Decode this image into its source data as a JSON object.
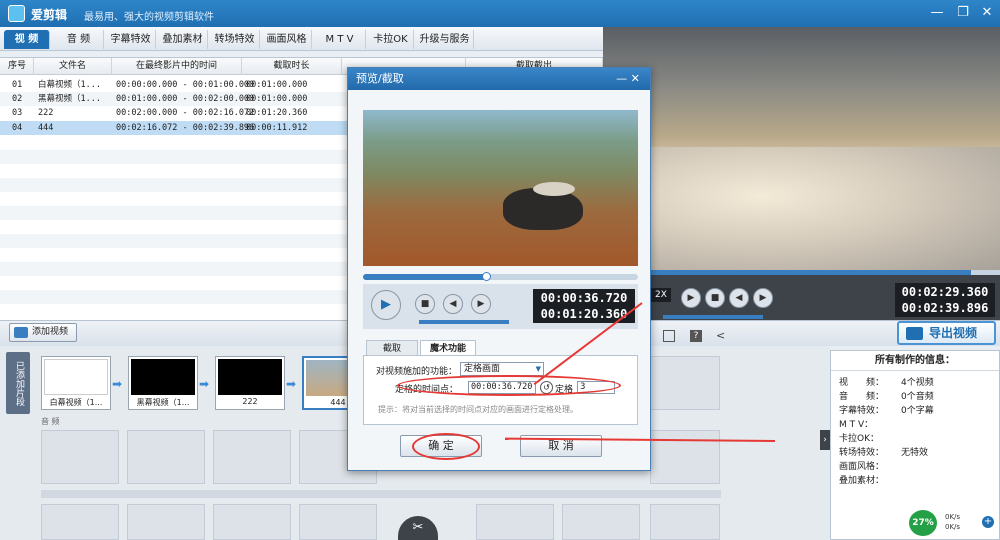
{
  "window": {
    "title": "爱剪辑",
    "slogan": "最易用、强大的视频剪辑软件"
  },
  "tabs": [
    "视 频",
    "音 频",
    "字幕特效",
    "叠加素材",
    "转场特效",
    "画面风格",
    "M T V",
    "卡拉OK",
    "升级与服务"
  ],
  "table": {
    "headers": [
      "序号",
      "文件名",
      "在最终影片中的时间",
      "截取时长"
    ],
    "rows": [
      {
        "no": "01",
        "name": "白幕视频（1...",
        "time": "00:00:00.000 - 00:01:00.000",
        "dur": "00:01:00.000"
      },
      {
        "no": "02",
        "name": "黑幕视频（1...",
        "time": "00:01:00.000 - 00:02:00.000",
        "dur": "00:01:00.000"
      },
      {
        "no": "03",
        "name": "222",
        "time": "00:02:00.000 - 00:02:16.072",
        "dur": "00:01:20.360"
      },
      {
        "no": "04",
        "name": "444",
        "time": "00:02:16.072 - 00:02:39.896",
        "dur": "00:00:11.912"
      }
    ]
  },
  "preview": {
    "time_current": "00:02:29.360",
    "time_total": "00:02:39.896",
    "speed": "2X",
    "side_header": "截取截出"
  },
  "export_label": "导出视频",
  "add_video_label": "添加视频",
  "clip_panel": {
    "side_label": "已添加片段",
    "clips": [
      "白幕视频（1...",
      "黑幕视频（1...",
      "222",
      "444"
    ],
    "audio_label": "音 频"
  },
  "info": {
    "title": "所有制作的信息：",
    "rows": [
      {
        "k": "视　　频：",
        "v": "4个视频"
      },
      {
        "k": "音　　频：",
        "v": "0个音频"
      },
      {
        "k": "字幕特效：",
        "v": "0个字幕"
      },
      {
        "k": "M T V：",
        "v": ""
      },
      {
        "k": "卡拉OK：",
        "v": ""
      },
      {
        "k": "转场特效：",
        "v": "无特效"
      },
      {
        "k": "画面风格：",
        "v": ""
      },
      {
        "k": "叠加素材：",
        "v": ""
      }
    ],
    "badge": "27%",
    "net_up": "0K/s",
    "net_down": "0K/s"
  },
  "modal": {
    "title": "预览/截取",
    "time_current": "00:00:36.720",
    "time_total": "00:01:20.360",
    "tabs": [
      "截取",
      "魔术功能"
    ],
    "func_label": "对视频施加的功能：",
    "func_value": "定格画面",
    "freeze_time_label": "定格的时间点：",
    "freeze_time_value": "00:00:36.720",
    "freeze_dur_label": "定格",
    "freeze_dur_value": "3",
    "hint": "提示：将对当前选择的时间点对应的画面进行定格处理。",
    "ok_label": "确 定",
    "cancel_label": "取 消"
  },
  "seek_progress": 0.46
}
